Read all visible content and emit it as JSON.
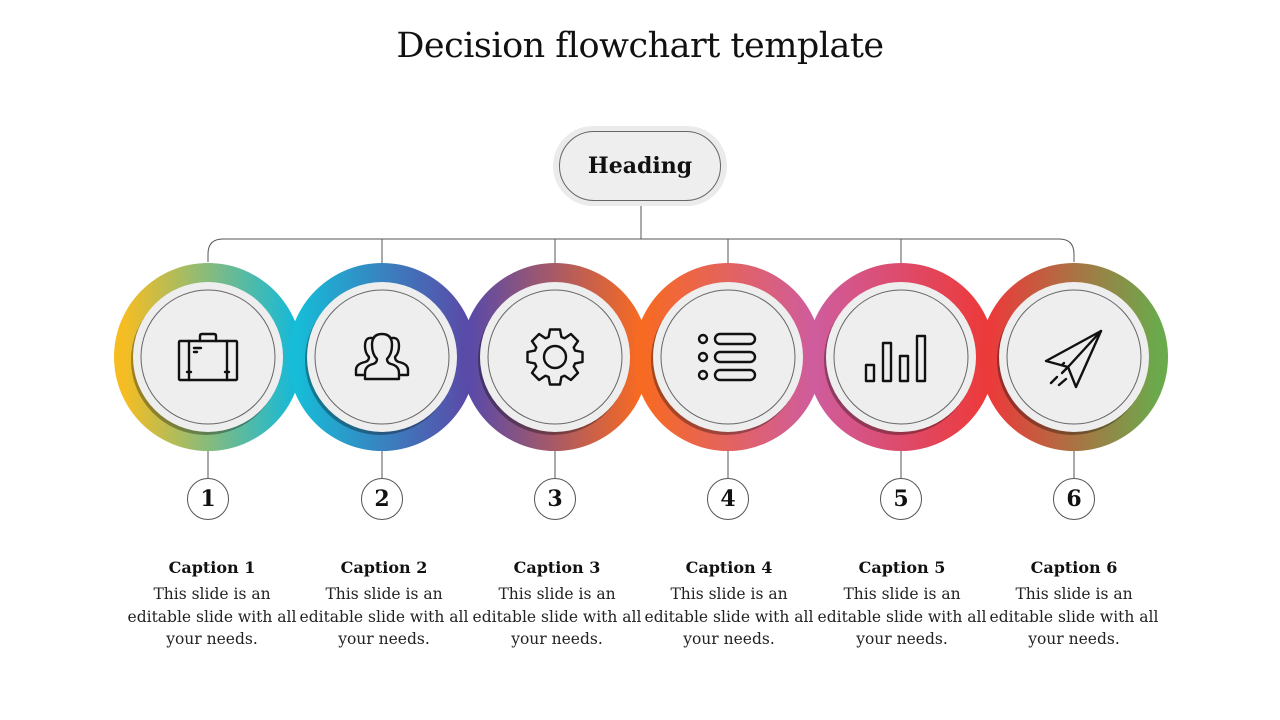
{
  "title": "Decision flowchart template",
  "heading": "Heading",
  "steps": [
    {
      "number": "1",
      "icon": "briefcase-icon",
      "caption": "Caption 1",
      "text": "This slide is an editable slide with all your needs.",
      "colors": [
        "#f6bd22",
        "#18b9d6"
      ]
    },
    {
      "number": "2",
      "icon": "users-icon",
      "caption": "Caption 2",
      "text": "This slide is an editable slide with all your needs.",
      "colors": [
        "#16bcd8",
        "#5a4aa8"
      ]
    },
    {
      "number": "3",
      "icon": "gear-icon",
      "caption": "Caption 3",
      "text": "This slide is an editable slide with all your needs.",
      "colors": [
        "#5a4aa8",
        "#f76a22"
      ]
    },
    {
      "number": "4",
      "icon": "list-icon",
      "caption": "Caption 4",
      "text": "This slide is an editable slide with all your needs.",
      "colors": [
        "#f76a22",
        "#cf5c9c"
      ]
    },
    {
      "number": "5",
      "icon": "bar-chart-icon",
      "caption": "Caption 5",
      "text": "This slide is an editable slide with all your needs.",
      "colors": [
        "#cf5c9c",
        "#ec3a3a"
      ]
    },
    {
      "number": "6",
      "icon": "paper-plane-icon",
      "caption": "Caption 6",
      "text": "This slide is an editable slide with all your needs.",
      "colors": [
        "#ec3a3a",
        "#6aaa4c"
      ]
    }
  ]
}
